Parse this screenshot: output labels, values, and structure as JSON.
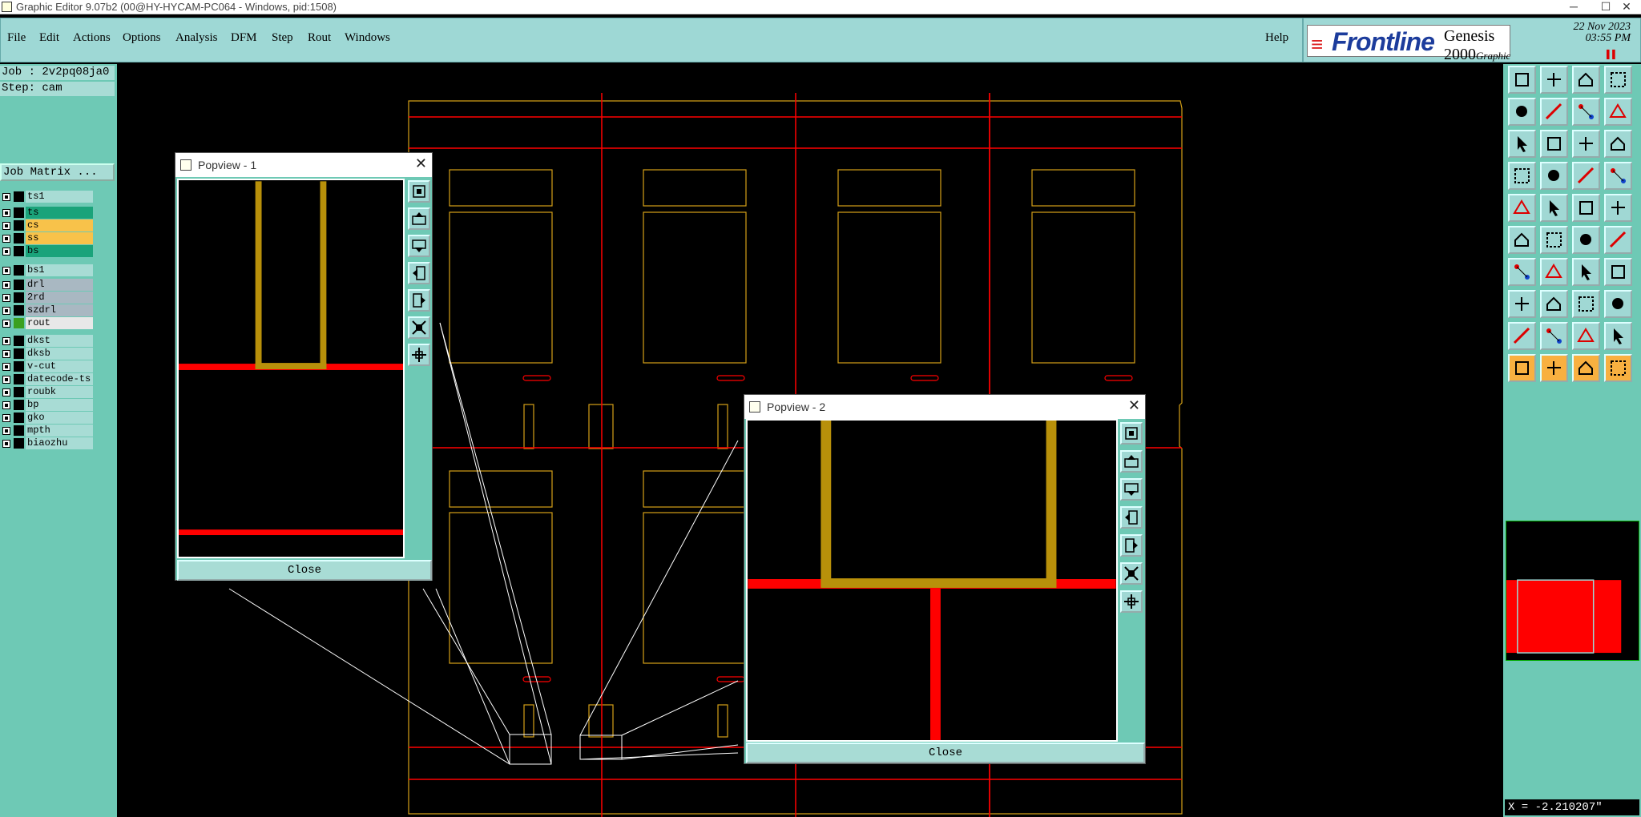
{
  "window": {
    "title": "Graphic Editor 9.07b2 (00@HY-HYCAM-PC064 - Windows, pid:1508)",
    "min": "─",
    "max": "☐",
    "close": "✕"
  },
  "menu": {
    "items": [
      "File",
      "Edit",
      "Actions",
      "Options",
      "Analysis",
      "DFM",
      "Step",
      "Rout",
      "Windows"
    ],
    "help": "Help"
  },
  "brand": {
    "logo": "Frontline",
    "product": "Genesis 2000",
    "subtitle": "Graphic Editor",
    "date": "22 Nov 2023",
    "time": "03:55 PM",
    "marker": "▌▌"
  },
  "job": {
    "job": "Job : 2v2pq08ja0",
    "step": "Step: cam",
    "matrix": "Job Matrix ..."
  },
  "layers": [
    {
      "name": "ts1",
      "color": "#000000",
      "bg": "#a8dcd5"
    },
    {
      "name": "ts",
      "color": "#000000",
      "bg": "#1aa37a"
    },
    {
      "name": "cs",
      "color": "#000000",
      "bg": "#f8c24a"
    },
    {
      "name": "ss",
      "color": "#000000",
      "bg": "#f8c24a"
    },
    {
      "name": "bs",
      "color": "#000000",
      "bg": "#1aa37a"
    },
    {
      "name": "bs1",
      "color": "#000000",
      "bg": "#a8dcd5"
    },
    {
      "name": "drl",
      "color": "#000000",
      "bg": "#a9b8c2"
    },
    {
      "name": "2rd",
      "color": "#000000",
      "bg": "#a9b8c2"
    },
    {
      "name": "szdrl",
      "color": "#000000",
      "bg": "#a9b8c2"
    },
    {
      "name": "rout",
      "color": "#3aa020",
      "bg": "#e8e8e8"
    },
    {
      "name": "dkst",
      "color": "#000000",
      "bg": "#a8dcd5"
    },
    {
      "name": "dksb",
      "color": "#000000",
      "bg": "#a8dcd5"
    },
    {
      "name": "v-cut",
      "color": "#000000",
      "bg": "#a8dcd5"
    },
    {
      "name": "datecode-ts",
      "color": "#000000",
      "bg": "#a8dcd5"
    },
    {
      "name": "roubk",
      "color": "#000000",
      "bg": "#a8dcd5"
    },
    {
      "name": "bp",
      "color": "#000000",
      "bg": "#a8dcd5"
    },
    {
      "name": "gko",
      "color": "#000000",
      "bg": "#a8dcd5"
    },
    {
      "name": "mpth",
      "color": "#000000",
      "bg": "#a8dcd5"
    },
    {
      "name": "biaozhu",
      "color": "#000000",
      "bg": "#a8dcd5"
    }
  ],
  "toolbar_icons": [
    "open-job-icon",
    "save-icon",
    "home-icon",
    "zoom-in-icon",
    "move-left-icon",
    "move-right-icon",
    "snap-icon",
    "s-icon",
    "fit-icon",
    "center-icon",
    "one-to-two-icon",
    "help-icon",
    "measure-icon",
    "cut-icon",
    "snap-grid-icon",
    "grid-icon",
    "pad-icon",
    "line-icon",
    "dash-icon",
    "circle-icon",
    "connect-icon",
    "cross-icon",
    "point-icon",
    "edit-icon",
    "angle-icon",
    "diag-icon",
    "arc-icon",
    "ff-icon",
    "node-icon",
    "minus-icon",
    "split-icon",
    "group-icon",
    "tri-a-icon",
    "tri-b-icon",
    "tri-c-icon",
    "tri-d-icon",
    "select-icon",
    "select-box-icon",
    "select-poly-icon",
    "route-icon"
  ],
  "popview1": {
    "title": "Popview - 1",
    "close": "Close"
  },
  "popview2": {
    "title": "Popview - 2",
    "close": "Close"
  },
  "status": {
    "coords": "X = -2.210207\""
  },
  "colors": {
    "accent": "#9ed8d5",
    "panel": "#6ec9b5",
    "red": "#ff0000",
    "gold": "#b8900a"
  }
}
